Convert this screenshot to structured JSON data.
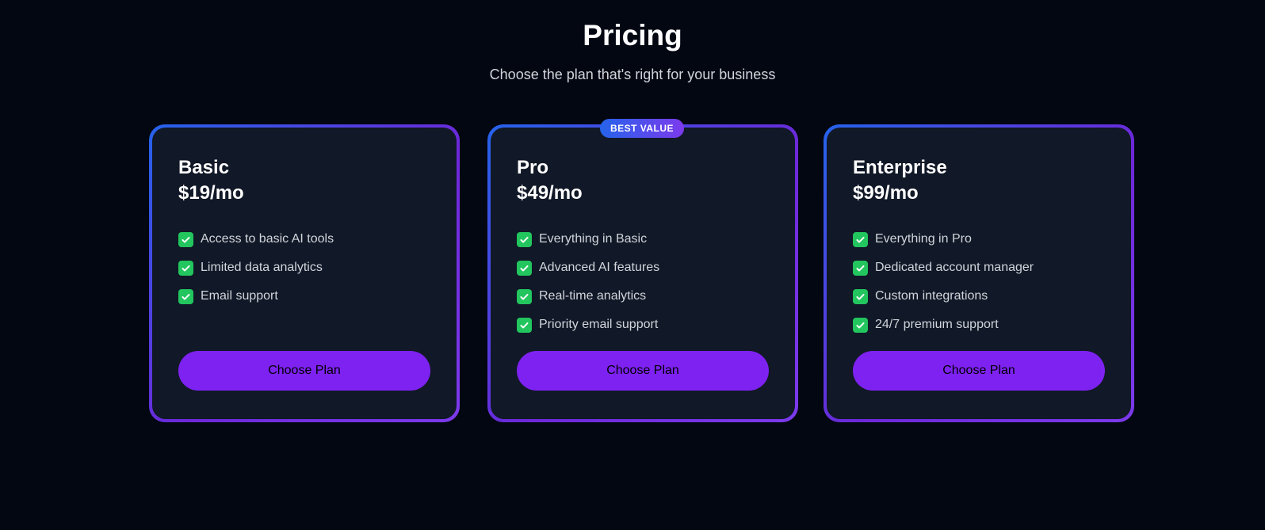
{
  "header": {
    "title": "Pricing",
    "subtitle": "Choose the plan that's right for your business"
  },
  "plans": [
    {
      "name": "Basic",
      "price": "$19/mo",
      "features": [
        "Access to basic AI tools",
        "Limited data analytics",
        "Email support"
      ],
      "button_label": "Choose Plan"
    },
    {
      "name": "Pro",
      "price": "$49/mo",
      "badge": "BEST VALUE",
      "features": [
        "Everything in Basic",
        "Advanced AI features",
        "Real-time analytics",
        "Priority email support"
      ],
      "button_label": "Choose Plan"
    },
    {
      "name": "Enterprise",
      "price": "$99/mo",
      "features": [
        "Everything in Pro",
        "Dedicated account manager",
        "Custom integrations",
        "24/7 premium support"
      ],
      "button_label": "Choose Plan"
    }
  ],
  "icons": {
    "feature": "check-icon"
  },
  "colors": {
    "background": "#030712",
    "card": "#111827",
    "border_start": "#2563eb",
    "border_end": "#7c3aed",
    "button": "#7e22f2",
    "check": "#22c55e"
  }
}
